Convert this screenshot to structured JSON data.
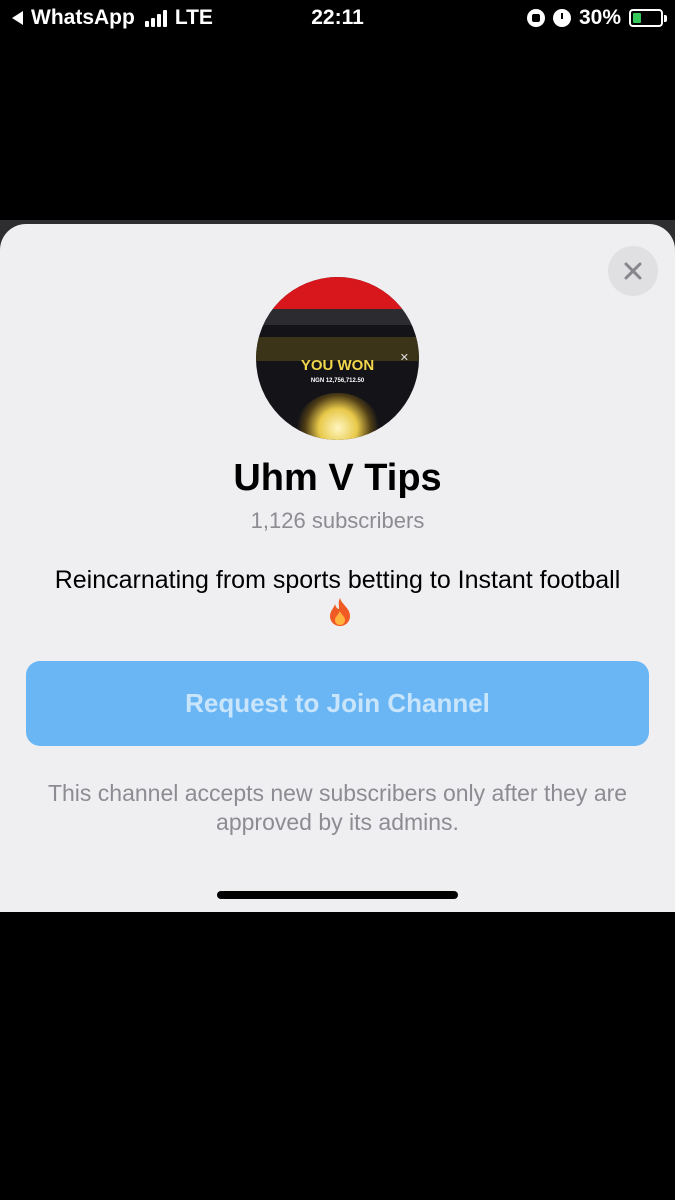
{
  "status_bar": {
    "back_app": "WhatsApp",
    "network": "LTE",
    "time": "22:11",
    "battery_percent": "30%",
    "battery_level": 0.3,
    "battery_color": "#35c759",
    "icons": [
      "back-arrow-icon",
      "signal-icon",
      "orientation-lock-icon",
      "alarm-icon",
      "battery-charging-icon"
    ]
  },
  "sheet": {
    "close_icon": "close-icon",
    "avatar": {
      "headline": "YOU WON",
      "amount": "NGN 12,756,712.50"
    },
    "channel_name": "Uhm V Tips",
    "subscribers": "1,126 subscribers",
    "description": "Reincarnating from sports betting to Instant football",
    "description_emoji": "fire-icon",
    "join_button_label": "Request to Join Channel",
    "approval_note": "This channel accepts new subscribers only after they are approved by its admins.",
    "accent_color": "#6ab6f5"
  }
}
